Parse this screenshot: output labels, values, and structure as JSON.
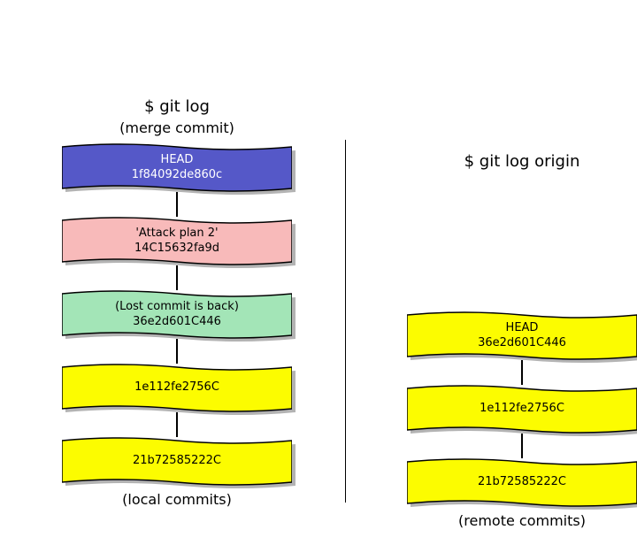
{
  "colors": {
    "blue": "#5558c8",
    "pink": "#f8baba",
    "green": "#a3e5b7",
    "yellow": "#fcfc00",
    "stroke": "#000000",
    "shadow": "#b3b3b3"
  },
  "left": {
    "title": "$ git log",
    "subtitle": "(merge commit)",
    "footer": "(local commits)",
    "nodes": [
      {
        "line1": "HEAD",
        "line2": "1f84092de860c",
        "fill": "blue",
        "textColor": "white"
      },
      {
        "line1": "'Attack plan 2'",
        "line2": "14C15632fa9d",
        "fill": "pink",
        "textColor": "black"
      },
      {
        "line1": "(Lost commit is back)",
        "line2": "36e2d601C446",
        "fill": "green",
        "textColor": "black"
      },
      {
        "line1": "",
        "line2": "1e112fe2756C",
        "fill": "yellow",
        "textColor": "black"
      },
      {
        "line1": "",
        "line2": "21b72585222C",
        "fill": "yellow",
        "textColor": "black"
      }
    ]
  },
  "right": {
    "title": "$ git log origin",
    "footer": "(remote commits)",
    "nodes": [
      {
        "line1": "HEAD",
        "line2": "36e2d601C446",
        "fill": "yellow",
        "textColor": "black"
      },
      {
        "line1": "",
        "line2": "1e112fe2756C",
        "fill": "yellow",
        "textColor": "black"
      },
      {
        "line1": "",
        "line2": "21b72585222C",
        "fill": "yellow",
        "textColor": "black"
      }
    ]
  }
}
